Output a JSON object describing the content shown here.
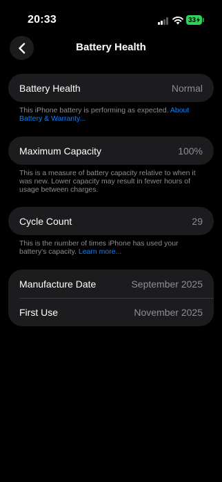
{
  "status_bar": {
    "time": "20:33",
    "battery_level": "33"
  },
  "nav": {
    "title": "Battery Health"
  },
  "battery_health": {
    "label": "Battery Health",
    "value": "Normal",
    "note": "This iPhone battery is performing as expected. ",
    "note_link": "About Battery & Warranty..."
  },
  "maximum_capacity": {
    "label": "Maximum Capacity",
    "value": "100%",
    "note": "This is a measure of battery capacity relative to when it was new. Lower capacity may result in fewer hours of usage between charges."
  },
  "cycle_count": {
    "label": "Cycle Count",
    "value": "29",
    "note": "This is the number of times iPhone has used your battery's capacity. ",
    "note_link": "Learn more..."
  },
  "dates": {
    "manufacture_label": "Manufacture Date",
    "manufacture_value": "September 2025",
    "first_use_label": "First Use",
    "first_use_value": "November 2025"
  },
  "colors": {
    "background": "#000000",
    "card": "#1c1c1e",
    "secondary_text": "#8e8e93",
    "link": "#0a84ff",
    "battery_charging": "#30d158"
  },
  "icons": {
    "back": "chevron-left-icon",
    "signal": "cellular-signal-icon",
    "wifi": "wifi-icon",
    "battery": "battery-charging-icon"
  }
}
